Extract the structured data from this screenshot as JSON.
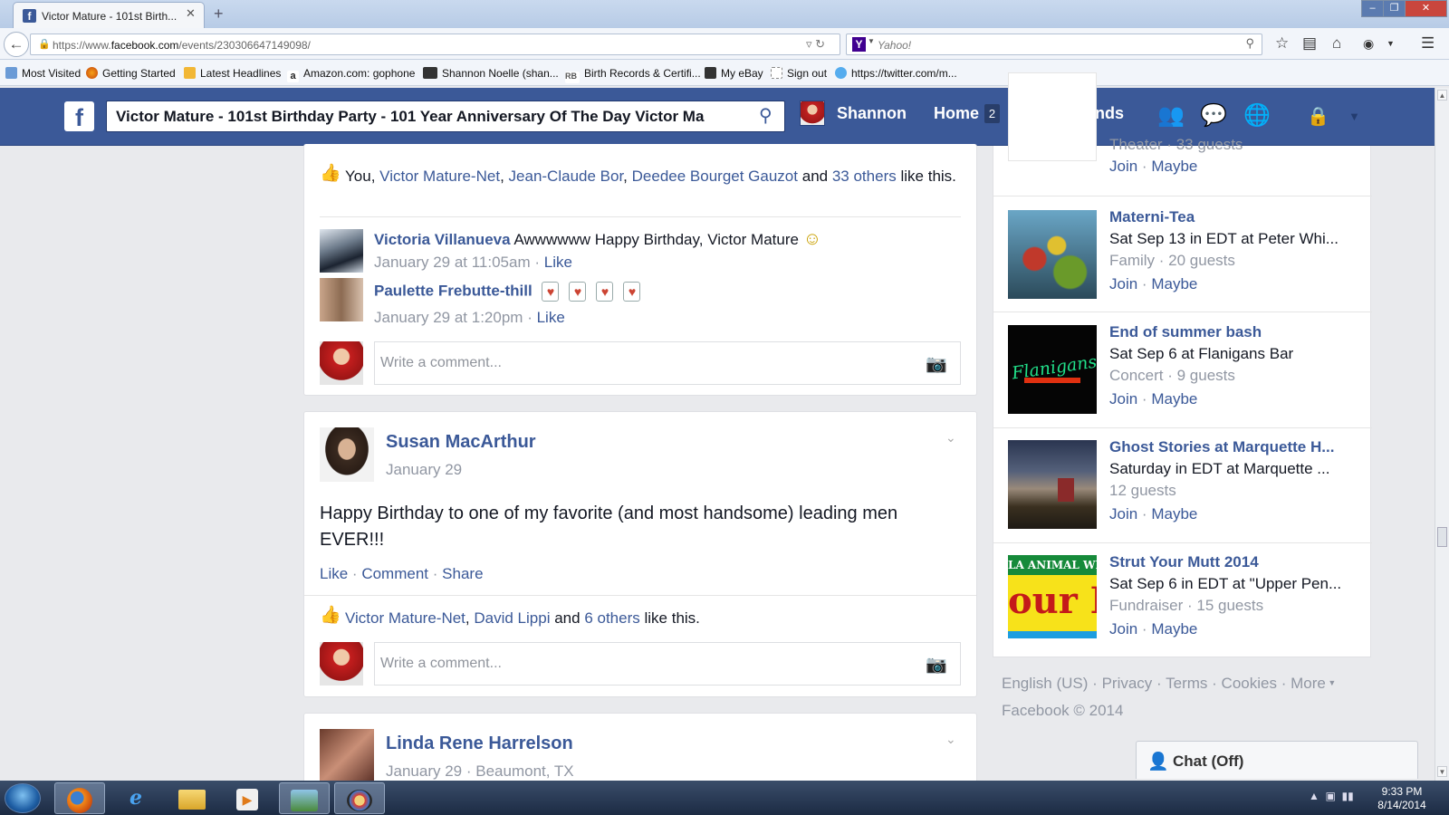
{
  "browser": {
    "tab_title": "Victor Mature - 101st Birth...",
    "url_prefix": "https://www.",
    "url_domain": "facebook.com",
    "url_path": "/events/230306647149098/",
    "search_engine_placeholder": "Yahoo!",
    "bookmarks": [
      "Most Visited",
      "Getting Started",
      "Latest Headlines",
      "Amazon.com: gophone",
      "Shannon Noelle (shan...",
      "Birth Records & Certifi...",
      "My eBay",
      "Sign out",
      "https://twitter.com/m..."
    ]
  },
  "fb_header": {
    "logo": "f",
    "search_value": "Victor Mature - 101st Birthday Party - 101 Year Anniversary Of The Day Victor Ma",
    "user_name": "Shannon",
    "home_label": "Home",
    "home_badge": "2",
    "find_friends": "Find Friends"
  },
  "feed": {
    "post1_likes": {
      "you": "You,",
      "liker1": "Victor Mature-Net",
      "sep1": ",",
      "liker2": "Jean-Claude Bor",
      "sep2": ",",
      "liker3": "Deedee Bourget Gauzot",
      "and": "and",
      "others": "33 others",
      "suffix": "like",
      "suffix2": "this."
    },
    "comments": [
      {
        "author": "Victoria Villanueva",
        "text": "Awwwwww Happy Birthday, Victor Mature",
        "emoji": "☺",
        "time": "January 29 at 11:05am",
        "like": "Like"
      },
      {
        "author": "Paulette Frebutte-thill",
        "time": "January 29 at 1:20pm",
        "like": "Like"
      }
    ],
    "comment_placeholder": "Write a comment...",
    "post2": {
      "author": "Susan MacArthur",
      "date": "January 29",
      "text_line1": "Happy Birthday to one of my favorite (and most handsome) leading men",
      "text_line2": "EVER!!!",
      "actions": {
        "like": "Like",
        "comment": "Comment",
        "share": "Share",
        "sep": "·"
      },
      "likes": {
        "liker1": "Victor Mature-Net",
        "sep": ",",
        "liker2": "David Lippi",
        "and": "and",
        "others": "6 others",
        "suffix": "like this."
      }
    },
    "post3": {
      "author": "Linda Rene Harrelson",
      "date": "January 29",
      "location": "Beaumont, TX",
      "sep": "·"
    }
  },
  "events": [
    {
      "title": "",
      "line1": "Theater · 33 guests",
      "join": "Join",
      "maybe": "Maybe"
    },
    {
      "title": "Materni-Tea",
      "line1": "Sat Sep 13 in EDT at Peter Whi...",
      "line2": "Family · 20 guests",
      "join": "Join",
      "maybe": "Maybe"
    },
    {
      "title": "End of summer bash",
      "line1": "Sat Sep 6 at Flanigans Bar",
      "line2": "Concert · 9 guests",
      "join": "Join",
      "maybe": "Maybe",
      "img_text": "Flanigans"
    },
    {
      "title": "Ghost Stories at Marquette H...",
      "line1": "Saturday in EDT at Marquette ...",
      "line2": "12 guests",
      "join": "Join",
      "maybe": "Maybe"
    },
    {
      "title": "Strut Your Mutt 2014",
      "line1": "Sat Sep 6 in EDT at \"Upper Pen...",
      "line2": "Fundraiser · 15 guests",
      "join": "Join",
      "maybe": "Maybe",
      "img_text_top": "LA ANIMAL WE",
      "img_text_main": "our Mu"
    }
  ],
  "event_sep": "·",
  "footer": {
    "links": [
      "English (US)",
      "Privacy",
      "Terms",
      "Cookies",
      "More"
    ],
    "sep": "·",
    "copyright": "Facebook © 2014"
  },
  "chat": {
    "label": "Chat (Off)"
  },
  "taskbar": {
    "time": "9:33 PM",
    "date": "8/14/2014"
  },
  "colors": {
    "fb_blue": "#3b5998",
    "link": "#3b5998",
    "bg": "#e9eaed"
  }
}
